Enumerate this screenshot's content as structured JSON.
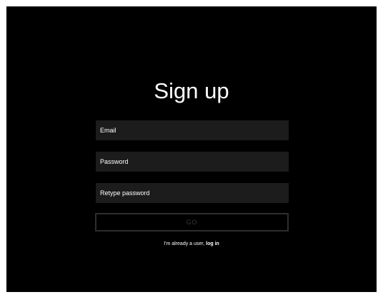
{
  "page": {
    "title": "Sign up"
  },
  "form": {
    "email_placeholder": "Email",
    "password_placeholder": "Password",
    "retype_placeholder": "Retype password",
    "go_label": "GO"
  },
  "footer": {
    "prefix": "I'm already a user, ",
    "login_label": "log in"
  },
  "colors": {
    "background": "#000000",
    "field_background": "#1c1c1c",
    "button_border": "#2e2e2e",
    "text": "#ffffff"
  }
}
